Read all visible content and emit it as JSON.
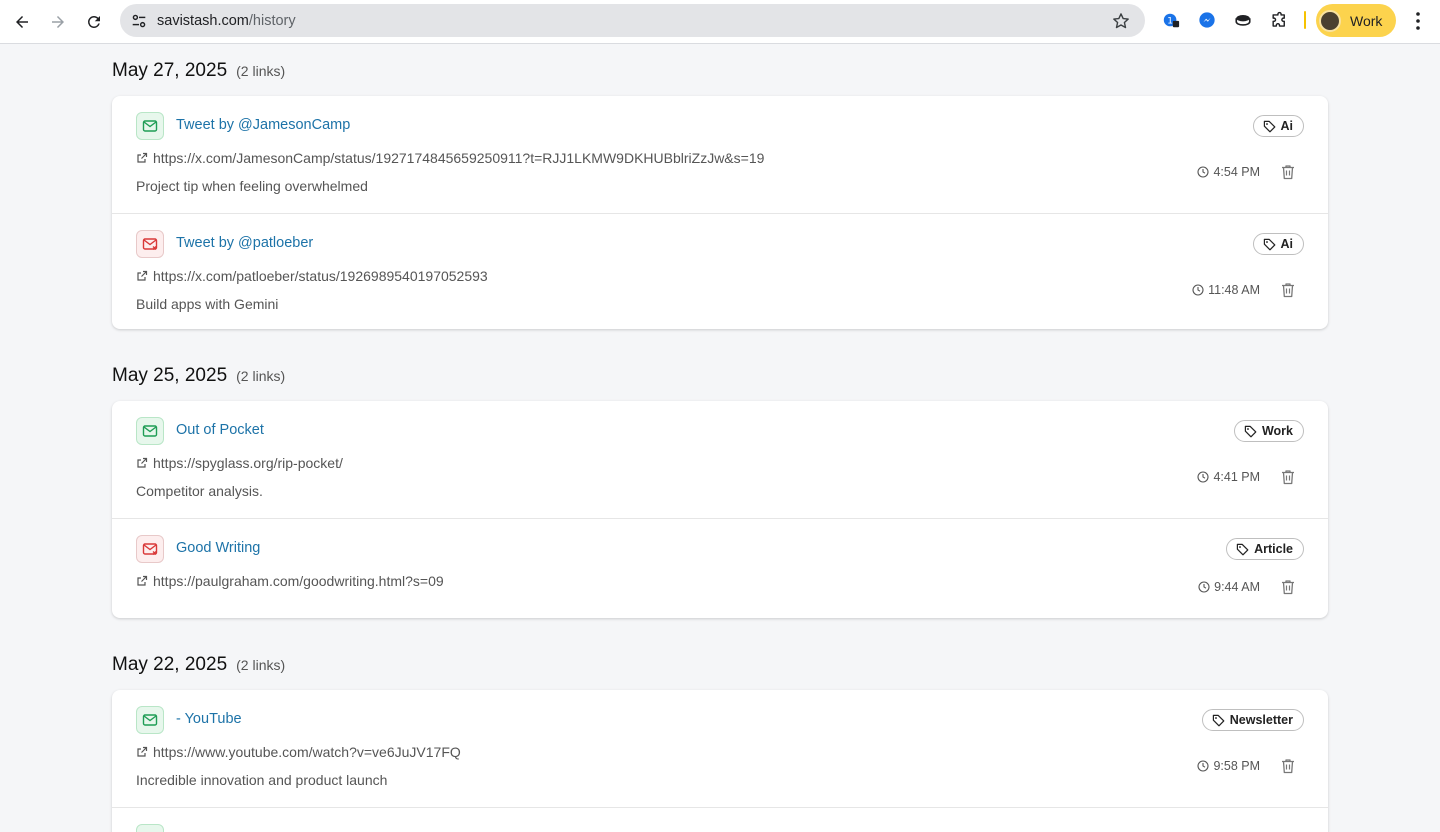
{
  "browser": {
    "url_host": "savistash.com",
    "url_path": "/history",
    "profile_label": "Work"
  },
  "days": [
    {
      "date": "May 27, 2025",
      "count": "(2 links)",
      "items": [
        {
          "title": "Tweet by @JamesonCamp",
          "url": "https://x.com/JamesonCamp/status/1927174845659250911?t=RJJ1LKMW9DKHUBblriZzJw&s=19",
          "description": "Project tip when feeling overwhelmed",
          "tag": "Ai",
          "time": "4:54 PM",
          "status": "ok"
        },
        {
          "title": "Tweet by @patloeber",
          "url": "https://x.com/patloeber/status/1926989540197052593",
          "description": "Build apps with Gemini",
          "tag": "Ai",
          "time": "11:48 AM",
          "status": "err"
        }
      ]
    },
    {
      "date": "May 25, 2025",
      "count": "(2 links)",
      "items": [
        {
          "title": "Out of Pocket",
          "url": "https://spyglass.org/rip-pocket/",
          "description": "Competitor analysis.",
          "tag": "Work",
          "time": "4:41 PM",
          "status": "ok"
        },
        {
          "title": "Good Writing",
          "url": "https://paulgraham.com/goodwriting.html?s=09",
          "description": "",
          "tag": "Article",
          "time": "9:44 AM",
          "status": "err"
        }
      ]
    },
    {
      "date": "May 22, 2025",
      "count": "(2 links)",
      "items": [
        {
          "title": "- YouTube",
          "url": "https://www.youtube.com/watch?v=ve6JuJV17FQ",
          "description": "Incredible innovation and product launch",
          "tag": "Newsletter",
          "time": "9:58 PM",
          "status": "ok"
        }
      ]
    }
  ]
}
